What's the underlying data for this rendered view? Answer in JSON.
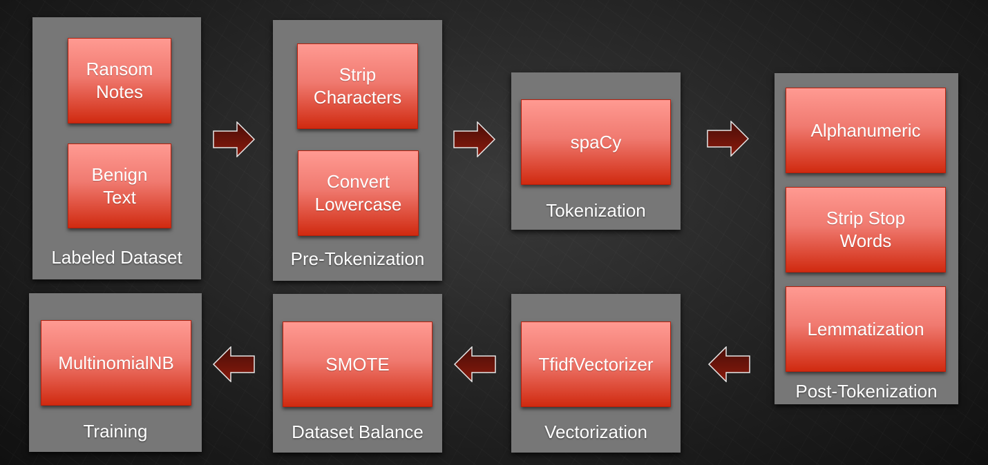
{
  "diagram": {
    "panels": [
      {
        "id": "labeled-dataset",
        "label": "Labeled Dataset",
        "steps": [
          "Ransom\nNotes",
          "Benign\nText"
        ]
      },
      {
        "id": "pre-tokenization",
        "label": "Pre-Tokenization",
        "steps": [
          "Strip\nCharacters",
          "Convert\nLowercase"
        ]
      },
      {
        "id": "tokenization",
        "label": "Tokenization",
        "steps": [
          "spaCy"
        ]
      },
      {
        "id": "post-tokenization",
        "label": "Post-Tokenization",
        "steps": [
          "Alphanumeric",
          "Strip Stop\nWords",
          "Lemmatization"
        ]
      },
      {
        "id": "vectorization",
        "label": "Vectorization",
        "steps": [
          "TfidfVectorizer"
        ]
      },
      {
        "id": "dataset-balance",
        "label": "Dataset Balance",
        "steps": [
          "SMOTE"
        ]
      },
      {
        "id": "training",
        "label": "Training",
        "steps": [
          "MultinomialNB"
        ]
      }
    ],
    "arrows": [
      {
        "from": "labeled-dataset",
        "to": "pre-tokenization",
        "direction": "right"
      },
      {
        "from": "pre-tokenization",
        "to": "tokenization",
        "direction": "right"
      },
      {
        "from": "tokenization",
        "to": "post-tokenization",
        "direction": "right"
      },
      {
        "from": "post-tokenization",
        "to": "vectorization",
        "direction": "left"
      },
      {
        "from": "vectorization",
        "to": "dataset-balance",
        "direction": "left"
      },
      {
        "from": "dataset-balance",
        "to": "training",
        "direction": "left"
      }
    ],
    "colors": {
      "panel": "#777777",
      "step_top": "#ff9a92",
      "step_bottom": "#d02a10",
      "arrow_top": "#4a0e08",
      "arrow_bottom": "#8a1a0c",
      "arrow_outline": "#e8e8e8",
      "text": "#ffffff"
    }
  }
}
